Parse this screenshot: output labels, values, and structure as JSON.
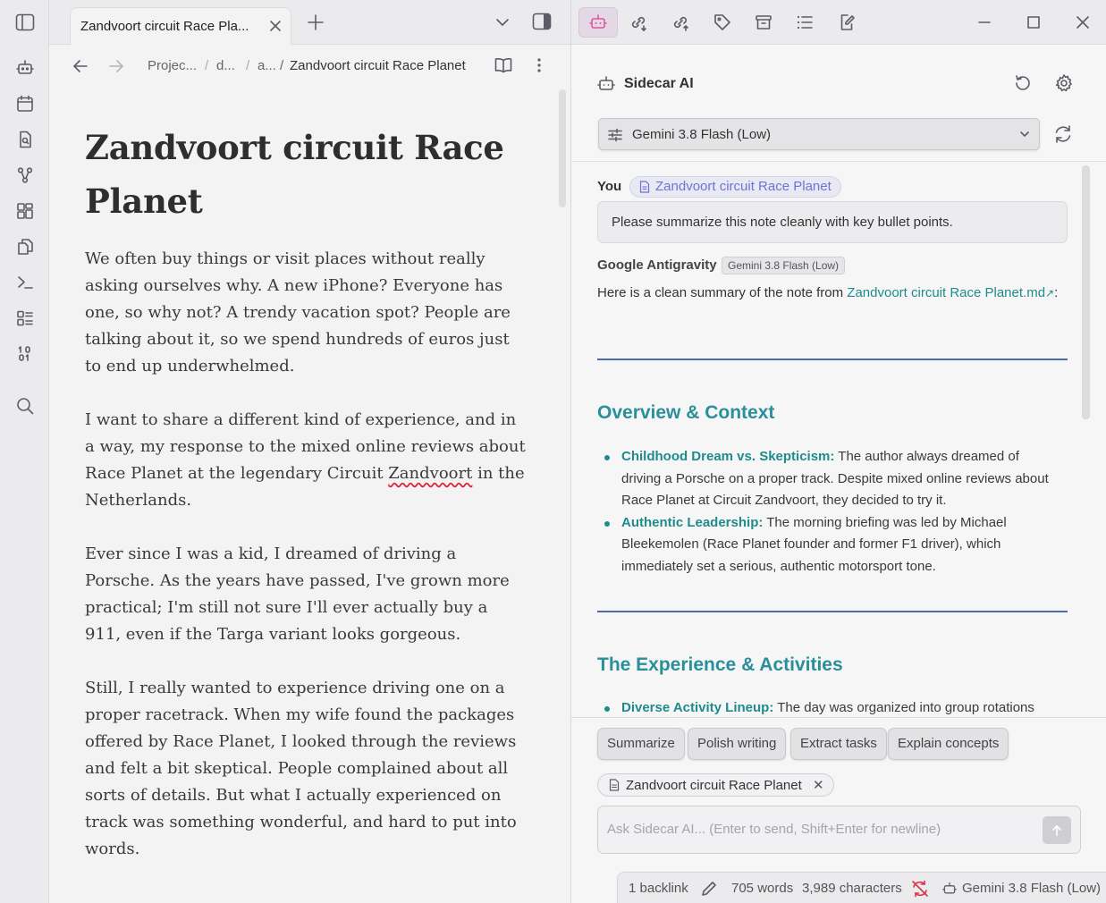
{
  "tab": {
    "title": "Zandvoort circuit Race Pla..."
  },
  "breadcrumb": {
    "p1": "Projec...",
    "sep1": "/",
    "p2": "d...",
    "sep2": "/",
    "p3": "a... /",
    "current": "Zandvoort circuit Race Planet"
  },
  "note": {
    "title": "Zandvoort circuit Race Planet",
    "paragraphs": {
      "p1": "We often buy things or visit places without really asking ourselves why. A new iPhone? Everyone has one, so why not? A trendy vacation spot? People are talking about it, so we spend hundreds of euros just to end up underwhelmed.",
      "p2a": "I want to share a different kind of experience, and in a way, my response to the mixed online reviews about Race Planet at the legendary Circuit ",
      "p2b": "Zandvoort",
      "p2c": " in the Netherlands.",
      "p3": "Ever since I was a kid, I dreamed of driving a Porsche. As the years have passed, I've grown more practical; I'm still not sure I'll ever actually buy a 911, even if the Targa variant looks gorgeous.",
      "p4": "Still, I really wanted to experience driving one on a proper racetrack. When my wife found the packages offered by Race Planet, I looked through the reviews and felt a bit skeptical. People complained about all sorts of details. But what I actually experienced on track was something wonderful, and hard to put into words."
    }
  },
  "sidecar": {
    "title": "Sidecar AI",
    "model": "Gemini 3.8 Flash (Low)",
    "you_label": "You",
    "note_chip": "Zandvoort circuit Race Planet",
    "user_message": "Please summarize this note cleanly with key bullet points.",
    "agent_name": "Google Antigravity",
    "agent_model": "Gemini 3.8 Flash (Low)",
    "answer_intro": "Here is a clean summary of the note from ",
    "answer_link": "Zandvoort circuit Race Planet.md",
    "answer_colon": ":",
    "section1": "Overview & Context",
    "bullets1": [
      {
        "label": "Childhood Dream vs. Skepticism:",
        "text": " The author always dreamed of driving a Porsche on a proper track. Despite mixed online reviews about Race Planet at Circuit Zandvoort, they decided to try it."
      },
      {
        "label": "Authentic Leadership:",
        "text": " The morning briefing was led by Michael Bleekemolen (Race Planet founder and former F1 driver), which immediately set a serious, authentic motorsport tone."
      }
    ],
    "section2": "The Experience & Activities",
    "bullets2": [
      {
        "label": "Diverse Activity Lineup:",
        "text": " The day was organized into group rotations"
      }
    ],
    "actions": [
      "Summarize",
      "Polish writing",
      "Extract tasks",
      "Explain concepts"
    ],
    "context_chip": "Zandvoort circuit Race Planet",
    "ask_placeholder": "Ask Sidecar AI... (Enter to send, Shift+Enter for newline)"
  },
  "status": {
    "backlinks": "1 backlink",
    "words": "705 words",
    "chars": "3,989 characters",
    "model": "Gemini 3.8 Flash (Low)"
  },
  "colors": {
    "accent_teal": "#1f8b8b",
    "heading_teal": "#2a8f9a",
    "chip_purple": "#6f72d6",
    "active_pink": "#e0559d"
  }
}
